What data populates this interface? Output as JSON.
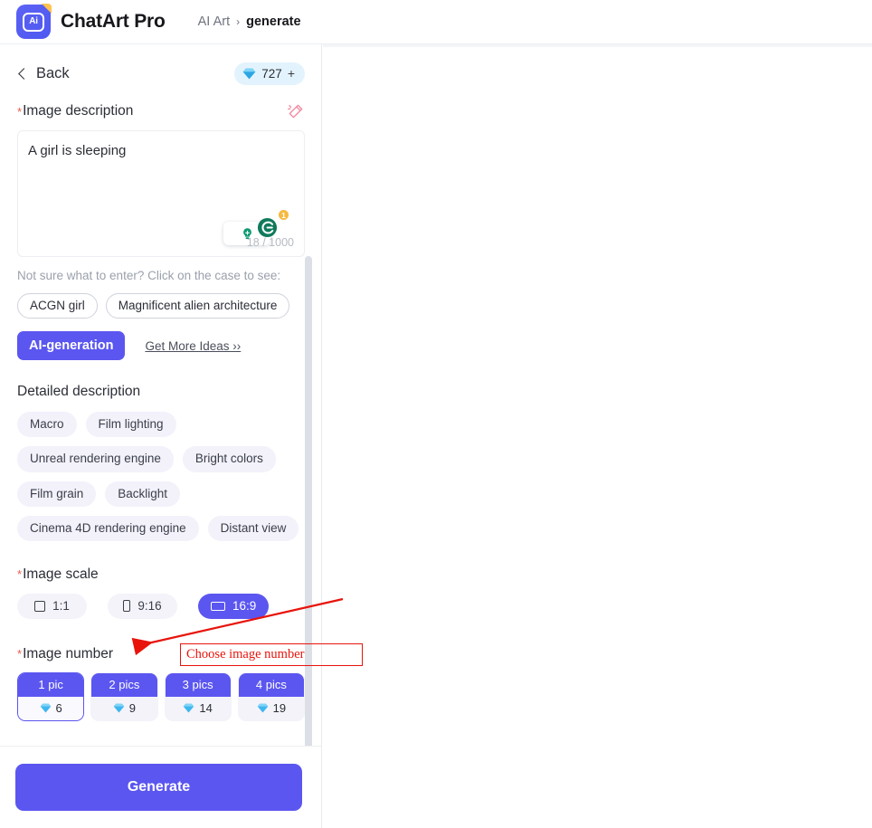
{
  "app": {
    "brand": "ChatArt Pro",
    "logo_glyph": "Ai"
  },
  "breadcrumb": {
    "root": "AI Art",
    "separator": "›",
    "current": "generate"
  },
  "panel": {
    "back_label": "Back",
    "credits": {
      "value": "727",
      "plus": "+"
    }
  },
  "image_description": {
    "label": "Image description",
    "required_mark": "*",
    "value": "A girl is sleeping",
    "counter": "18 / 1000",
    "grammarly_badge": "1"
  },
  "suggestions": {
    "hint": "Not sure what to enter? Click on the case to see:",
    "chips": [
      "ACGN girl",
      "Magnificent alien architecture"
    ],
    "ai_generation_label": "AI-generation",
    "more_ideas_label": "Get More Ideas ››"
  },
  "detailed_description": {
    "label": "Detailed description",
    "tags": [
      "Macro",
      "Film lighting",
      "Unreal rendering engine",
      "Bright colors",
      "Film grain",
      "Backlight",
      "Cinema 4D rendering engine",
      "Distant view"
    ]
  },
  "image_scale": {
    "label": "Image scale",
    "required_mark": "*",
    "options": [
      {
        "label": "1:1",
        "icon": "square-icon",
        "selected": false
      },
      {
        "label": "9:16",
        "icon": "portrait-icon",
        "selected": false
      },
      {
        "label": "16:9",
        "icon": "landscape-icon",
        "selected": true
      }
    ]
  },
  "image_number": {
    "label": "Image number",
    "required_mark": "*",
    "options": [
      {
        "label": "1 pic",
        "cost": "6",
        "selected": true
      },
      {
        "label": "2 pics",
        "cost": "9",
        "selected": false
      },
      {
        "label": "3 pics",
        "cost": "14",
        "selected": false
      },
      {
        "label": "4 pics",
        "cost": "19",
        "selected": false
      }
    ]
  },
  "footer": {
    "generate_label": "Generate"
  },
  "annotation": {
    "note_text": "Choose image number",
    "color": "#e8140c"
  },
  "colors": {
    "accent_purple": "#5b56f0",
    "credit_pill_bg": "#e3f3fd",
    "tag_bg": "#f3f2fb",
    "required_red": "#f0584b",
    "annotation_red": "#e8140c"
  }
}
